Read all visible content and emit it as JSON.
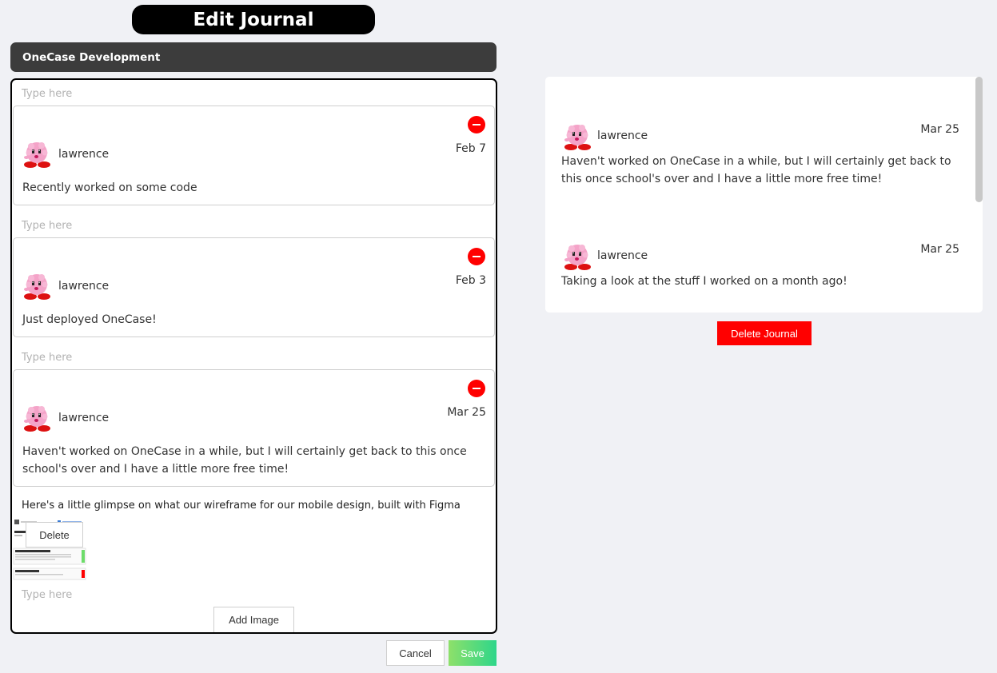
{
  "header": {
    "title": "Edit Journal"
  },
  "journal": {
    "name": "OneCase Development"
  },
  "editor": {
    "placeholder": "Type here",
    "entries": [
      {
        "author": "lawrence",
        "date": "Feb 7",
        "text": "Recently worked on some code"
      },
      {
        "author": "lawrence",
        "date": "Feb 3",
        "text": "Just deployed OneCase!"
      },
      {
        "author": "lawrence",
        "date": "Mar 25",
        "text": "Haven't worked on OneCase in a while, but I will certainly get back to this once school's over and I have a little more free time!"
      }
    ],
    "image_entry": {
      "text": "Here's a little glimpse on what our wireframe for our mobile design, built with Figma",
      "delete_label": "Delete"
    },
    "add_image_label": "Add Image"
  },
  "actions": {
    "cancel_label": "Cancel",
    "save_label": "Save"
  },
  "preview": {
    "entries": [
      {
        "author": "lawrence",
        "date": "Mar 25",
        "text": "Haven't worked on OneCase in a while, but I will certainly get back to this once school's over and I have a little more free time!"
      },
      {
        "author": "lawrence",
        "date": "Mar 25",
        "text": "Taking a look at the stuff I worked on a month ago!"
      }
    ],
    "delete_journal_label": "Delete Journal"
  },
  "colors": {
    "accent_red": "#ff0000",
    "save_green": "#2ed68a",
    "header_black": "#000000",
    "bar_gray": "#3c3c3c"
  },
  "icons": {
    "remove": "minus-circle-icon",
    "avatar": "kirby-avatar-icon"
  }
}
